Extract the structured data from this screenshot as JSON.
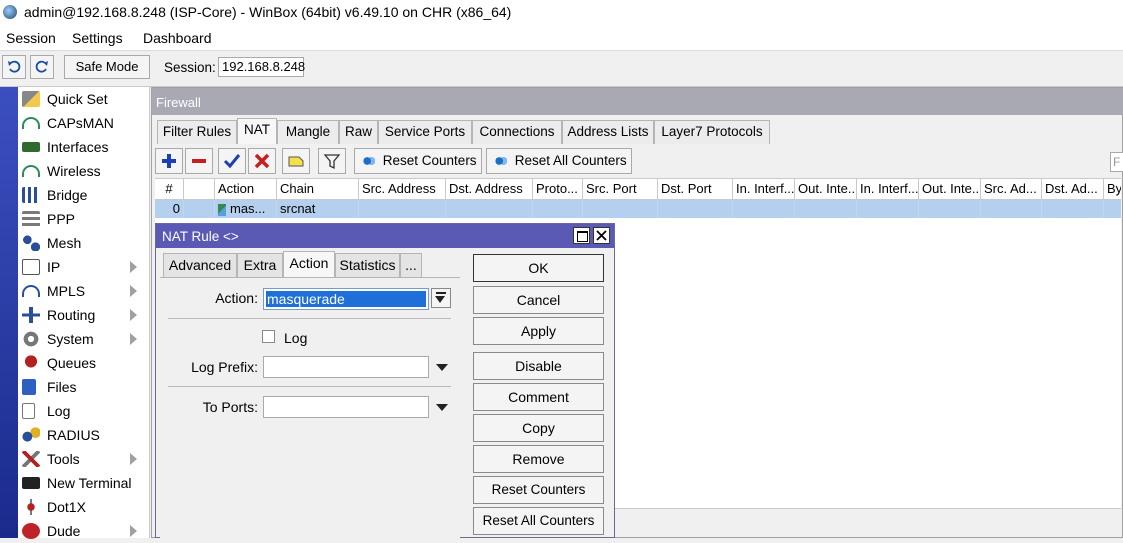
{
  "window": {
    "title": "admin@192.168.8.248 (ISP-Core) - WinBox (64bit) v6.49.10 on CHR (x86_64)"
  },
  "menu": [
    "Session",
    "Settings",
    "Dashboard"
  ],
  "toolbar": {
    "safe_mode": "Safe Mode",
    "session_label": "Session:",
    "session_value": "192.168.8.248"
  },
  "sidebar": {
    "items": [
      {
        "label": "Quick Set",
        "icon": "wand-icon",
        "submenu": false
      },
      {
        "label": "CAPsMAN",
        "icon": "antenna-icon",
        "submenu": false
      },
      {
        "label": "Interfaces",
        "icon": "interfaces-icon",
        "submenu": false
      },
      {
        "label": "Wireless",
        "icon": "wireless-icon",
        "submenu": false
      },
      {
        "label": "Bridge",
        "icon": "bridge-icon",
        "submenu": false
      },
      {
        "label": "PPP",
        "icon": "ppp-icon",
        "submenu": false
      },
      {
        "label": "Mesh",
        "icon": "mesh-icon",
        "submenu": false
      },
      {
        "label": "IP",
        "icon": "ip-icon",
        "submenu": true
      },
      {
        "label": "MPLS",
        "icon": "mpls-icon",
        "submenu": true
      },
      {
        "label": "Routing",
        "icon": "routing-icon",
        "submenu": true
      },
      {
        "label": "System",
        "icon": "gear-icon",
        "submenu": true
      },
      {
        "label": "Queues",
        "icon": "queues-icon",
        "submenu": false
      },
      {
        "label": "Files",
        "icon": "folder-icon",
        "submenu": false
      },
      {
        "label": "Log",
        "icon": "log-icon",
        "submenu": false
      },
      {
        "label": "RADIUS",
        "icon": "radius-icon",
        "submenu": false
      },
      {
        "label": "Tools",
        "icon": "tools-icon",
        "submenu": true
      },
      {
        "label": "New Terminal",
        "icon": "terminal-icon",
        "submenu": false
      },
      {
        "label": "Dot1X",
        "icon": "dot1x-icon",
        "submenu": false
      },
      {
        "label": "Dude",
        "icon": "dude-icon",
        "submenu": true
      }
    ]
  },
  "firewall": {
    "title": "Firewall",
    "tabs": [
      "Filter Rules",
      "NAT",
      "Mangle",
      "Raw",
      "Service Ports",
      "Connections",
      "Address Lists",
      "Layer7 Protocols"
    ],
    "active_tab": "NAT",
    "buttons": {
      "reset_counters": "Reset Counters",
      "reset_all_counters": "Reset All Counters"
    },
    "find_placeholder": "F",
    "columns": [
      "#",
      "",
      "Action",
      "Chain",
      "Src. Address",
      "Dst. Address",
      "Proto...",
      "Src. Port",
      "Dst. Port",
      "In. Interf...",
      "Out. Inte...",
      "In. Interf...",
      "Out. Inte...",
      "Src. Ad...",
      "Dst. Ad...",
      "By"
    ],
    "rows": [
      {
        "num": "0",
        "action": "mas...",
        "chain": "srcnat"
      }
    ]
  },
  "nat_dialog": {
    "title": "NAT Rule <>",
    "tabs": [
      "Advanced",
      "Extra",
      "Action",
      "Statistics",
      "..."
    ],
    "active_tab": "Action",
    "action_label": "Action:",
    "action_value": "masquerade",
    "log_label": "Log",
    "log_checked": false,
    "log_prefix_label": "Log Prefix:",
    "log_prefix_value": "",
    "to_ports_label": "To Ports:",
    "to_ports_value": "",
    "buttons": [
      "OK",
      "Cancel",
      "Apply",
      "Disable",
      "Comment",
      "Copy",
      "Remove",
      "Reset Counters",
      "Reset All Counters"
    ]
  }
}
